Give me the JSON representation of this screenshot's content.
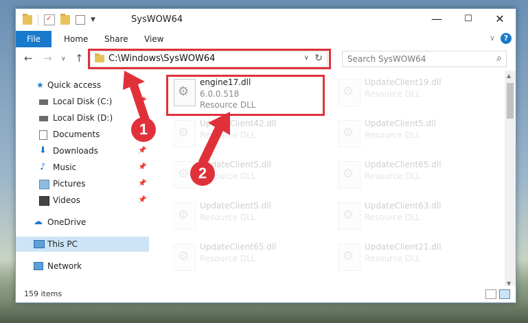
{
  "window": {
    "title": "SysWOW64",
    "controls": {
      "minimize": "—",
      "maximize": "☐",
      "close": "✕"
    }
  },
  "ribbon": {
    "file": "File",
    "tabs": [
      "Home",
      "Share",
      "View"
    ],
    "help": "?"
  },
  "address": {
    "path": "C:\\Windows\\SysWOW64",
    "search_placeholder": "Search SysWOW64"
  },
  "nav": {
    "quick_access": "Quick access",
    "items": [
      {
        "label": "Local Disk (C:)",
        "icon": "drive-icon",
        "pinned": true
      },
      {
        "label": "Local Disk (D:)",
        "icon": "drive-icon",
        "pinned": false
      },
      {
        "label": "Documents",
        "icon": "documents-icon",
        "pinned": true
      },
      {
        "label": "Downloads",
        "icon": "downloads-icon",
        "pinned": true
      },
      {
        "label": "Music",
        "icon": "music-icon",
        "pinned": true
      },
      {
        "label": "Pictures",
        "icon": "pictures-icon",
        "pinned": true
      },
      {
        "label": "Videos",
        "icon": "videos-icon",
        "pinned": true
      }
    ],
    "onedrive": "OneDrive",
    "this_pc": "This PC",
    "network": "Network"
  },
  "files": [
    {
      "name": "engine17.dll",
      "version": "6.0.0.518",
      "type": "Resource DLL"
    },
    {
      "name": "UpdateClient19.dll",
      "type": "Resource DLL"
    },
    {
      "name": "UpdateClient42.dll",
      "type": "Resource DLL"
    },
    {
      "name": "UpdateClient5.dll",
      "type": "Resource DLL"
    },
    {
      "name": "UpdateClient5.dll",
      "type": "Resource DLL"
    },
    {
      "name": "UpdateClient65.dll",
      "type": "Resource DLL"
    },
    {
      "name": "UpdateClient5.dll",
      "type": "Resource DLL"
    },
    {
      "name": "UpdateClient63.dll",
      "type": "Resource DLL"
    },
    {
      "name": "UpdateClient65.dll",
      "type": "Resource DLL"
    },
    {
      "name": "UpdateClient21.dll",
      "type": "Resource DLL"
    }
  ],
  "status": {
    "count": "159 items"
  },
  "annotations": {
    "step1": "1",
    "step2": "2"
  },
  "colors": {
    "accent": "#1979ca",
    "annotation": "#e0313a",
    "selected": "#cce4f7"
  }
}
